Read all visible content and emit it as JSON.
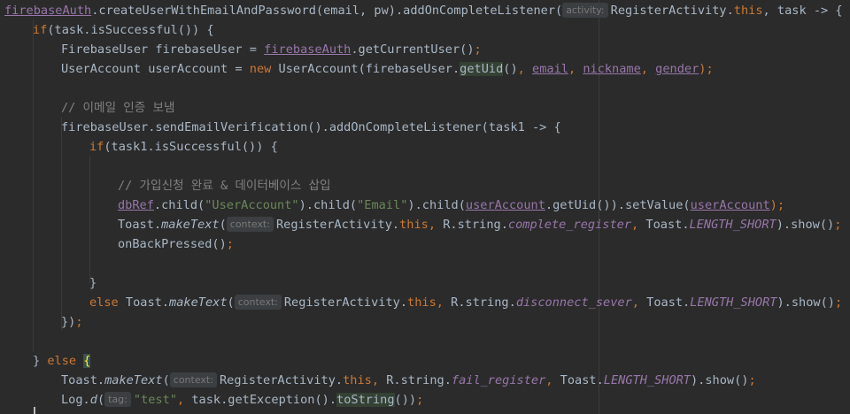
{
  "lines": [
    {
      "indent": 0,
      "tokens": [
        {
          "t": "firebaseAuth",
          "c": "t-ulvar"
        },
        {
          "t": ".createUserWithEmailAndPassword(email, pw).addOnCompleteListener("
        },
        {
          "hint": "activity:"
        },
        {
          "t": "RegisterActivity."
        },
        {
          "t": "this",
          "c": "t-kw"
        },
        {
          "t": ", task -> {"
        }
      ]
    },
    {
      "indent": 1,
      "tokens": [
        {
          "t": "if",
          "c": "t-kw"
        },
        {
          "t": "(task.isSuccessful()) {"
        }
      ]
    },
    {
      "indent": 2,
      "tokens": [
        {
          "t": "FirebaseUser firebaseUser = "
        },
        {
          "t": "firebaseAuth",
          "c": "t-ulvar"
        },
        {
          "t": ".getCurrentUser()"
        },
        {
          "t": ";",
          "c": "t-kw"
        }
      ]
    },
    {
      "indent": 2,
      "tokens": [
        {
          "t": "UserAccount userAccount = "
        },
        {
          "t": "new ",
          "c": "t-kw"
        },
        {
          "t": "UserAccount(firebaseUser."
        },
        {
          "t": "getUid",
          "c": "t-hl"
        },
        {
          "t": "()"
        },
        {
          "t": ", ",
          "c": "t-kw"
        },
        {
          "t": "email",
          "c": "t-ulvar"
        },
        {
          "t": ", ",
          "c": "t-kw"
        },
        {
          "t": "nickname",
          "c": "t-ulvar"
        },
        {
          "t": ", ",
          "c": "t-kw"
        },
        {
          "t": "gender",
          "c": "t-ulvar"
        },
        {
          "t": ");",
          "c": "t-kw"
        }
      ]
    },
    {
      "indent": 0,
      "tokens": []
    },
    {
      "indent": 2,
      "tokens": [
        {
          "t": "// 이메일 인증 보냄",
          "c": "t-cmt"
        }
      ]
    },
    {
      "indent": 2,
      "tokens": [
        {
          "t": "firebaseUser.sendEmailVerification().addOnCompleteListener(task1 -> {"
        }
      ]
    },
    {
      "indent": 3,
      "tokens": [
        {
          "t": "if",
          "c": "t-kw"
        },
        {
          "t": "(task1.isSuccessful()) {"
        }
      ]
    },
    {
      "indent": 0,
      "tokens": []
    },
    {
      "indent": 4,
      "tokens": [
        {
          "t": "// 가입신청 완료 & 데이터베이스 삽입",
          "c": "t-cmt"
        }
      ]
    },
    {
      "indent": 4,
      "tokens": [
        {
          "t": "dbRef",
          "c": "t-ulvar"
        },
        {
          "t": ".child("
        },
        {
          "t": "\"UserAccount\"",
          "c": "t-str"
        },
        {
          "t": ").child("
        },
        {
          "t": "\"Email\"",
          "c": "t-str"
        },
        {
          "t": ").child("
        },
        {
          "t": "userAccount",
          "c": "t-ulvar"
        },
        {
          "t": ".getUid()).setValue("
        },
        {
          "t": "userAccount",
          "c": "t-ulvar"
        },
        {
          "t": ");",
          "c": "t-kw"
        }
      ]
    },
    {
      "indent": 4,
      "tokens": [
        {
          "t": "Toast."
        },
        {
          "t": "makeText",
          "c": "t-static"
        },
        {
          "t": "("
        },
        {
          "hint": "context:"
        },
        {
          "t": "RegisterActivity."
        },
        {
          "t": "this",
          "c": "t-kw"
        },
        {
          "t": ", ",
          "c": "t-kw"
        },
        {
          "t": "R.string."
        },
        {
          "t": "complete_register",
          "c": "t-fielditalic"
        },
        {
          "t": ", ",
          "c": "t-kw"
        },
        {
          "t": "Toast."
        },
        {
          "t": "LENGTH_SHORT",
          "c": "t-fielditalic"
        },
        {
          "t": ").show()"
        },
        {
          "t": ";",
          "c": "t-kw"
        }
      ]
    },
    {
      "indent": 4,
      "tokens": [
        {
          "t": "onBackPressed()"
        },
        {
          "t": ";",
          "c": "t-kw"
        }
      ]
    },
    {
      "indent": 0,
      "tokens": []
    },
    {
      "indent": 3,
      "tokens": [
        {
          "t": "}"
        }
      ]
    },
    {
      "indent": 3,
      "tokens": [
        {
          "t": "else ",
          "c": "t-kw"
        },
        {
          "t": "Toast."
        },
        {
          "t": "makeText",
          "c": "t-static"
        },
        {
          "t": "("
        },
        {
          "hint": "context:"
        },
        {
          "t": "RegisterActivity."
        },
        {
          "t": "this",
          "c": "t-kw"
        },
        {
          "t": ", ",
          "c": "t-kw"
        },
        {
          "t": "R.string."
        },
        {
          "t": "disconnect_sever",
          "c": "t-fielditalic"
        },
        {
          "t": ", ",
          "c": "t-kw"
        },
        {
          "t": "Toast."
        },
        {
          "t": "LENGTH_SHORT",
          "c": "t-fielditalic"
        },
        {
          "t": ").show()"
        },
        {
          "t": ";",
          "c": "t-kw"
        }
      ]
    },
    {
      "indent": 2,
      "tokens": [
        {
          "t": "})"
        },
        {
          "t": ";",
          "c": "t-kw"
        }
      ]
    },
    {
      "indent": 0,
      "tokens": []
    },
    {
      "indent": 1,
      "tokens": [
        {
          "t": "} "
        },
        {
          "t": "else ",
          "c": "t-kw"
        },
        {
          "t": "{",
          "c": "t-brace-hl"
        }
      ]
    },
    {
      "indent": 2,
      "tokens": [
        {
          "t": "Toast."
        },
        {
          "t": "makeText",
          "c": "t-static"
        },
        {
          "t": "("
        },
        {
          "hint": "context:"
        },
        {
          "t": "RegisterActivity."
        },
        {
          "t": "this",
          "c": "t-kw"
        },
        {
          "t": ", ",
          "c": "t-kw"
        },
        {
          "t": "R.string."
        },
        {
          "t": "fail_register",
          "c": "t-fielditalic"
        },
        {
          "t": ", ",
          "c": "t-kw"
        },
        {
          "t": "Toast."
        },
        {
          "t": "LENGTH_SHORT",
          "c": "t-fielditalic"
        },
        {
          "t": ").show()"
        },
        {
          "t": ";",
          "c": "t-kw"
        }
      ]
    },
    {
      "indent": 2,
      "tokens": [
        {
          "t": "Log."
        },
        {
          "t": "d",
          "c": "t-static"
        },
        {
          "t": "("
        },
        {
          "hint": "tag:"
        },
        {
          "t": "\"test\"",
          "c": "t-str"
        },
        {
          "t": ", ",
          "c": "t-kw"
        },
        {
          "t": "task.getException()."
        },
        {
          "t": "toString",
          "c": "t-hl"
        },
        {
          "t": "())"
        },
        {
          "t": ";",
          "c": "t-kw"
        }
      ]
    }
  ]
}
